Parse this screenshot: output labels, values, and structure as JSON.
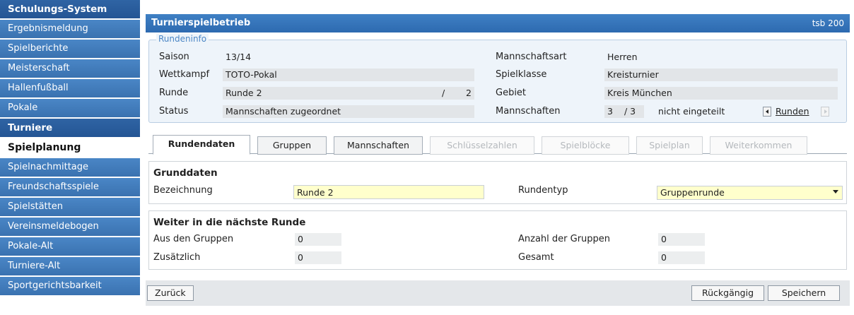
{
  "sidebar": {
    "items": [
      {
        "label": "Schulungs-System",
        "kind": "head"
      },
      {
        "label": "Ergebnismeldung",
        "kind": "item"
      },
      {
        "label": "Spielberichte",
        "kind": "item"
      },
      {
        "label": "Meisterschaft",
        "kind": "item"
      },
      {
        "label": "Hallenfußball",
        "kind": "item"
      },
      {
        "label": "Pokale",
        "kind": "item"
      },
      {
        "label": "Turniere",
        "kind": "head"
      },
      {
        "label": "Spielplanung",
        "kind": "active"
      },
      {
        "label": "Spielnachmittage",
        "kind": "item"
      },
      {
        "label": "Freundschaftsspiele",
        "kind": "item"
      },
      {
        "label": "Spielstätten",
        "kind": "item"
      },
      {
        "label": "Vereinsmeldebogen",
        "kind": "item"
      },
      {
        "label": "Pokale-Alt",
        "kind": "item"
      },
      {
        "label": "Turniere-Alt",
        "kind": "item"
      },
      {
        "label": "Sportgerichtsbarkeit",
        "kind": "item"
      }
    ]
  },
  "header": {
    "title": "Turnierspielbetrieb",
    "right_text": "tsb 200"
  },
  "rundeninfo": {
    "legend": "Rundeninfo",
    "saison_label": "Saison",
    "saison_value": "13/14",
    "wettkampf_label": "Wettkampf",
    "wettkampf_value": "TOTO-Pokal",
    "runde_label": "Runde",
    "runde_value": "Runde 2",
    "runde_sep": "/",
    "runde_total": "2",
    "status_label": "Status",
    "status_value": "Mannschaften zugeordnet",
    "mannschaftsart_label": "Mannschaftsart",
    "mannschaftsart_value": "Herren",
    "spielklasse_label": "Spielklasse",
    "spielklasse_value": "Kreisturnier",
    "gebiet_label": "Gebiet",
    "gebiet_value": "Kreis München",
    "mannschaften_label": "Mannschaften",
    "mannschaften_count": "3",
    "mannschaften_sep": "/ 3",
    "mannschaften_note": "nicht eingeteilt",
    "runden_link": "Runden"
  },
  "tabs": [
    {
      "label": "Rundendaten",
      "state": "active"
    },
    {
      "label": "Gruppen",
      "state": "normal"
    },
    {
      "label": "Mannschaften",
      "state": "normal"
    },
    {
      "label": "Schlüsselzahlen",
      "state": "disabled"
    },
    {
      "label": "Spielblöcke",
      "state": "disabled"
    },
    {
      "label": "Spielplan",
      "state": "disabled"
    },
    {
      "label": "Weiterkommen",
      "state": "disabled"
    }
  ],
  "grunddaten": {
    "title": "Grunddaten",
    "bezeichnung_label": "Bezeichnung",
    "bezeichnung_value": "Runde 2",
    "rundentyp_label": "Rundentyp",
    "rundentyp_value": "Gruppenrunde"
  },
  "weiter": {
    "title": "Weiter in die nächste Runde",
    "aus_label": "Aus den Gruppen",
    "aus_value": "0",
    "zusaetzlich_label": "Zusätzlich",
    "zusaetzlich_value": "0",
    "anzahl_label": "Anzahl der Gruppen",
    "anzahl_value": "0",
    "gesamt_label": "Gesamt",
    "gesamt_value": "0"
  },
  "footer": {
    "back_label": "Zurück",
    "undo_label": "Rückgängig",
    "save_label": "Speichern"
  }
}
